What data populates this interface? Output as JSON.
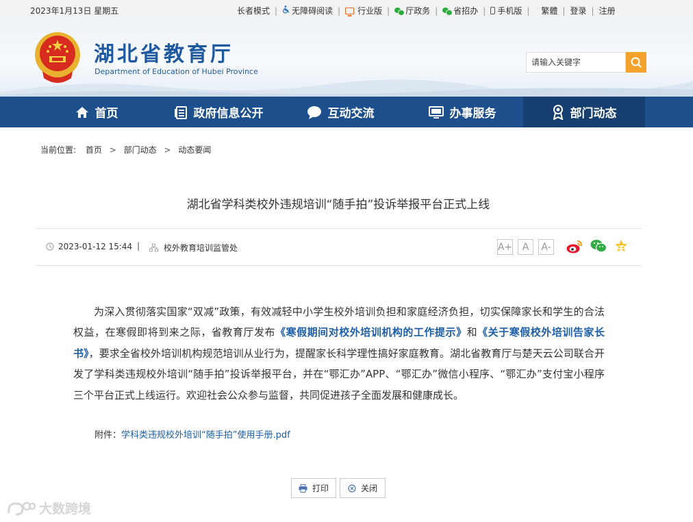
{
  "topbar": {
    "date": "2023年1月13日 星期五",
    "links": [
      {
        "label": "长者模式",
        "icon": ""
      },
      {
        "label": "无障碍阅读",
        "icon": "wheelchair-icon"
      },
      {
        "label": "行业版",
        "icon": "monitor-icon"
      },
      {
        "label": "厅政务",
        "icon": "wechat-icon"
      },
      {
        "label": "省招办",
        "icon": "wechat-icon"
      },
      {
        "label": "手机版",
        "icon": "phone-icon"
      }
    ],
    "trad": "繁體",
    "login": "登录",
    "register": "注册"
  },
  "header": {
    "title": "湖北省教育厅",
    "subtitle": "Department of Education of Hubei Province",
    "search_placeholder": "请输入关键字"
  },
  "nav": [
    {
      "label": "首页",
      "icon": "home-icon"
    },
    {
      "label": "政府信息公开",
      "icon": "document-list-icon"
    },
    {
      "label": "互动交流",
      "icon": "chat-bubble-icon"
    },
    {
      "label": "办事服务",
      "icon": "monitor-icon"
    },
    {
      "label": "部门动态",
      "icon": "award-icon",
      "active": true
    }
  ],
  "breadcrumb": {
    "prefix": "当前位置:",
    "items": [
      "首页",
      "部门动态",
      "动态要闻"
    ],
    "separator": ">"
  },
  "article": {
    "title": "湖北省学科类校外违规培训“随手拍”投诉举报平台正式上线",
    "date": "2023-01-12 15:44",
    "separator": "|",
    "department": "校外教育培训监管处",
    "font_sizes": [
      "A+",
      "A",
      "A-"
    ],
    "share": [
      "weibo-icon",
      "wechat-icon",
      "qzone-icon"
    ],
    "body": {
      "p1": "为深入贯彻落实国家“双减”政策，有效减轻中小学生校外培训负担和家庭经济负担，切实保障家长和学生的合法权益，在寒假即将到来之际，省教育厅发布",
      "doc1": "《寒假期间对校外培训机构的工作提示》",
      "p2": "和",
      "doc2": "《关于寒假校外培训告家长书》",
      "p3": "，要求全省校外培训机构规范培训从业行为，提醒家长科学理性搞好家庭教育。湖北省教育厅与楚天云公司联合开发了学科类违规校外培训“随手拍”投诉举报平台，并在“鄂汇办”APP、“鄂汇办”微信小程序、“鄂汇办”支付宝小程序三个平台正式上线运行。欢迎社会公众参与监督，共同促进孩子全面发展和健康成长。"
    },
    "attachment_label": "附件：",
    "attachment_file": "学科类违规校外培训“随手拍”使用手册.pdf"
  },
  "buttons": {
    "print": "打印",
    "close": "关闭"
  },
  "watermark": "大数跨境",
  "colors": {
    "nav": "#1d4f8c",
    "nav_active": "#163e6f",
    "link": "#1d5ea8",
    "search": "#f3a32c"
  }
}
